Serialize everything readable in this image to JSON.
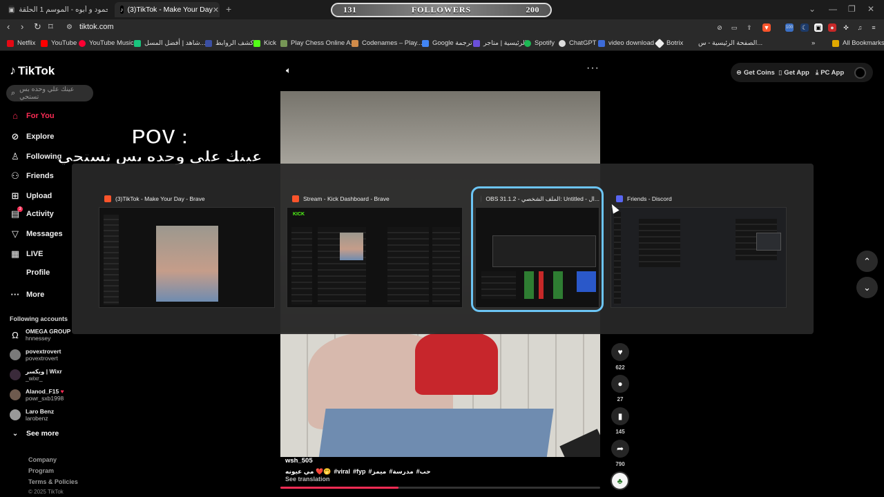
{
  "browser": {
    "tabs": [
      {
        "title": "شاهد حمود و أبوه - الموسم 1 الحلقة..."
      },
      {
        "title": "(3)TikTok - Make Your Day",
        "active": true
      }
    ],
    "new_tab": "+",
    "url": "tiktok.com",
    "followers_widget": {
      "count": "131",
      "label": "FOLLOWERS",
      "goal": "200"
    },
    "bookmarks": [
      "Netflix",
      "YouTube",
      "YouTube Music",
      "شاهد | أفضل المسل...",
      "كشف الروابط",
      "Kick",
      "Play Chess Online A...",
      "Codenames – Play...",
      "Google ترجمة",
      "الرئيسية | متاجر",
      "Spotify",
      "ChatGPT",
      "video download",
      "Botrix",
      "الصفحة الرئيسية - س...",
      "All Bookmarks"
    ],
    "extension_badge": "100"
  },
  "tiktok": {
    "logo": "TikTok",
    "search_placeholder": "عينك علي وحده بس تستحي",
    "nav": [
      {
        "label": "For You",
        "icon": "home-icon"
      },
      {
        "label": "Explore",
        "icon": "compass-icon"
      },
      {
        "label": "Following",
        "icon": "following-icon"
      },
      {
        "label": "Friends",
        "icon": "friends-icon"
      },
      {
        "label": "Upload",
        "icon": "upload-icon"
      },
      {
        "label": "Activity",
        "icon": "activity-icon"
      },
      {
        "label": "Messages",
        "icon": "messages-icon"
      },
      {
        "label": "LIVE",
        "icon": "live-icon"
      },
      {
        "label": "Profile",
        "icon": "profile-icon"
      },
      {
        "label": "More",
        "icon": "more-icon"
      }
    ],
    "activity_badge": "3",
    "following_title": "Following accounts",
    "following_accounts": [
      {
        "display": "OMEGA GROUP",
        "user": "hnnessey"
      },
      {
        "display": "povextrovert",
        "user": "povextrovert"
      },
      {
        "display": "ويكسر | Wixr",
        "user": "_wixr_"
      },
      {
        "display": "Alanod_F15",
        "user": "powr_sxb1998"
      },
      {
        "display": "Laro Benz",
        "user": "larobenz"
      }
    ],
    "see_more": "See more",
    "footer": [
      "Company",
      "Program",
      "Terms & Policies"
    ],
    "copyright": "© 2025 TikTok",
    "top_actions": [
      "Get Coins",
      "Get App",
      "PC App"
    ],
    "video": {
      "overlay_title": "POV :",
      "overlay_sub": "عينك علي وحده بس تستحي",
      "author": "wsh_505",
      "caption": [
        "مي عيونه ❤️🤭",
        "#viral",
        "#fyp",
        "#ميمز",
        "#مدرسة",
        "#حب"
      ],
      "see_translation": "See translation",
      "progress": 0.37
    },
    "actions": [
      {
        "icon": "heart-icon",
        "count": "622"
      },
      {
        "icon": "comment-icon",
        "count": "27"
      },
      {
        "icon": "bookmark-icon",
        "count": "145"
      },
      {
        "icon": "share-icon",
        "count": "790"
      }
    ]
  },
  "switcher": {
    "windows": [
      {
        "title": "(3)TikTok - Make Your Day - Brave",
        "icon": "brave-icon",
        "color": "#fb542b"
      },
      {
        "title": "Stream - Kick Dashboard - Brave",
        "icon": "brave-icon",
        "color": "#fb542b"
      },
      {
        "title": "OBS 31.1.2 - الملف الشخصي: Untitled - ال...",
        "icon": "obs-icon",
        "color": "#444444",
        "selected": true
      },
      {
        "title": "Friends - Discord",
        "icon": "discord-icon",
        "color": "#5865f2"
      }
    ]
  },
  "colors": {
    "accent": "#fe2c55",
    "selection": "#6cc5f5"
  }
}
